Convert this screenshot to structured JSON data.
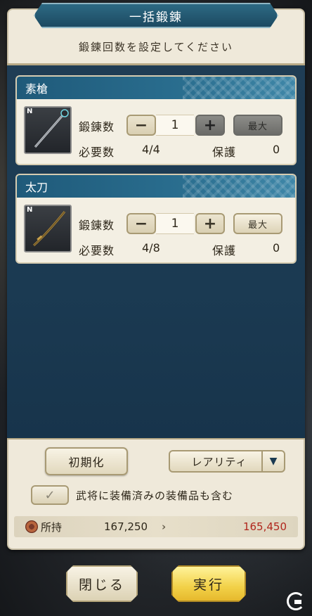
{
  "dialog": {
    "title": "一括鍛錬",
    "instruction": "鍛錬回数を設定してください"
  },
  "items": [
    {
      "name": "素槍",
      "rarity": "N",
      "icon": "spear-icon",
      "forge_label": "鍛錬数",
      "count": "1",
      "max_label": "最大",
      "max_state": "disabled",
      "plus_state": "disabled",
      "required_label": "必要数",
      "required_value": "4/4",
      "protect_label": "保護",
      "protect_value": "0"
    },
    {
      "name": "太刀",
      "rarity": "N",
      "icon": "katana-icon",
      "forge_label": "鍛錬数",
      "count": "1",
      "max_label": "最大",
      "max_state": "enabled",
      "plus_state": "enabled",
      "required_label": "必要数",
      "required_value": "4/8",
      "protect_label": "保護",
      "protect_value": "0"
    }
  ],
  "controls": {
    "reset_label": "初期化",
    "sort_selected": "レアリティ",
    "include_equipped_label": "武将に装備済みの装備品も含む",
    "include_equipped_checked": true
  },
  "owned": {
    "label": "所持",
    "current": "167,250",
    "arrow": "›",
    "after": "165,450"
  },
  "buttons": {
    "close_label": "閉じる",
    "execute_label": "実行"
  },
  "colors": {
    "after_value": "#b0261c",
    "execute_button": "#f2d148",
    "header": "#1f5a7a"
  }
}
